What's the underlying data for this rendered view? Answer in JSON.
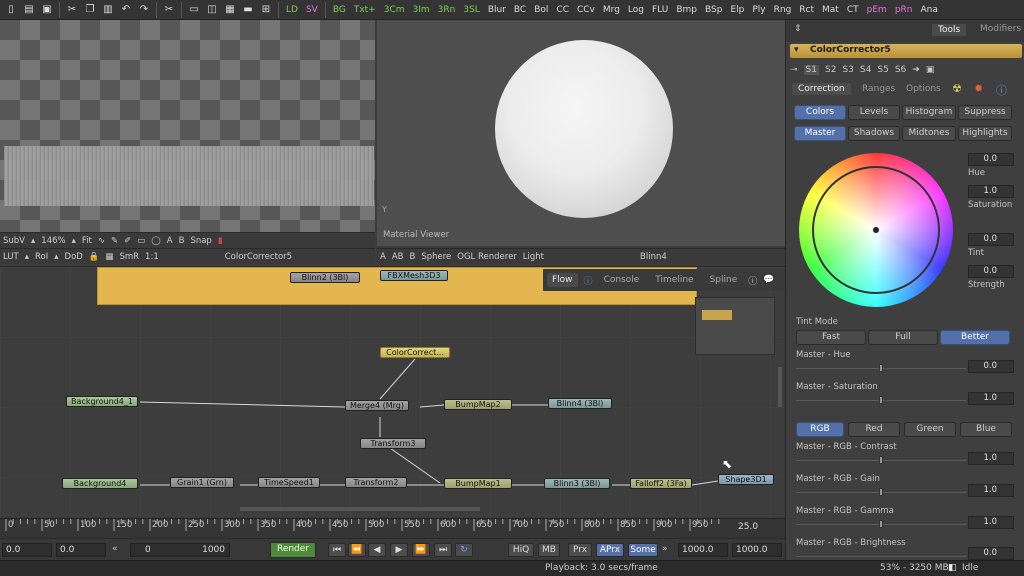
{
  "toolbar": {
    "buttons": [
      "LD",
      "SV",
      "BG",
      "Txt+",
      "3Cm",
      "3Im",
      "3Rn",
      "3SL",
      "Blur",
      "BC",
      "Bol",
      "CC",
      "CCv",
      "Mrg",
      "Log",
      "FLU",
      "Bmp",
      "BSp",
      "Elp",
      "Ply",
      "Rng",
      "Rct",
      "Mat",
      "CT",
      "pEm",
      "pRn",
      "Ana"
    ]
  },
  "viewer_left": {
    "toolbar1": {
      "subv": "SubV",
      "zoom": "146%",
      "fit": "Fit",
      "smr": "SmR",
      "snap": "Snap"
    },
    "toolbar2": {
      "lut": "LUT",
      "roi": "RoI",
      "dod": "DoD",
      "smr": "SmR",
      "ratio": "1:1",
      "node": "ColorCorrector5"
    }
  },
  "viewer_right": {
    "label": "Material Viewer",
    "toolbar": {
      "shape": "Sphere",
      "renderer": "OGL Renderer",
      "light": "Light",
      "node": "Blinn4"
    }
  },
  "flow": {
    "tabs": [
      "Flow",
      "Console",
      "Timeline",
      "Spline"
    ],
    "nodes": {
      "blinn2": "Blinn2 (3Bl)",
      "fbxmesh": "FBXMesh3D3",
      "colorcorrect": "ColorCorrect...",
      "background4_1": "Background4_1",
      "merge4": "Merge4 (Mrg)",
      "bumpmap2": "BumpMap2",
      "blinn4": "Blinn4 (3Bl)",
      "transform3": "Transform3",
      "background4": "Background4",
      "grain1": "Grain1 (Grn)",
      "timespeed1": "TimeSpeed1",
      "transform2": "Transform2",
      "bumpmap1": "BumpMap1",
      "blinn3": "Blinn3 (3Bl)",
      "falloff2": "Falloff2 (3Fa)",
      "shape3d1": "Shape3D1"
    }
  },
  "timeline": {
    "ticks": [
      "0",
      "50",
      "100",
      "150",
      "200",
      "250",
      "300",
      "350",
      "400",
      "450",
      "500",
      "550",
      "600",
      "650",
      "700",
      "750",
      "800",
      "850",
      "900",
      "950"
    ],
    "current_frame": "25.0"
  },
  "transport": {
    "start": "0.0",
    "global_start": "0.0",
    "range_start": "0",
    "range_end": "1000",
    "render": "Render",
    "hiq": "HiQ",
    "mb": "MB",
    "prx": "Prx",
    "aprx": "APrx",
    "some": "Some",
    "end": "1000.0",
    "global_end": "1000.0"
  },
  "status": {
    "playback": "Playback: 3.0 secs/frame",
    "memory": "53% - 3250 MB",
    "state": "Idle"
  },
  "rightpanel": {
    "tabs": [
      "Tools",
      "Modifiers"
    ],
    "tool_name": "ColorCorrector5",
    "slots": [
      "S1",
      "S2",
      "S3",
      "S4",
      "S5",
      "S6"
    ],
    "subtabs": [
      "Correction",
      "Ranges",
      "Options"
    ],
    "mode_buttons": [
      "Colors",
      "Levels",
      "Histogram",
      "Suppress"
    ],
    "range_buttons": [
      "Master",
      "Shadows",
      "Midtones",
      "Highlights"
    ],
    "wheel_values": [
      {
        "value": "0.0",
        "label": "Hue"
      },
      {
        "value": "1.0",
        "label": "Saturation"
      },
      {
        "value": "0.0",
        "label": "Tint"
      },
      {
        "value": "0.0",
        "label": "Strength"
      }
    ],
    "tint_mode_label": "Tint Mode",
    "tint_modes": [
      "Fast",
      "Full",
      "Better"
    ],
    "master_hue": {
      "label": "Master - Hue",
      "value": "0.0"
    },
    "master_saturation": {
      "label": "Master - Saturation",
      "value": "1.0"
    },
    "channels": [
      "RGB",
      "Red",
      "Green",
      "Blue"
    ],
    "sliders": [
      {
        "label": "Master - RGB - Contrast",
        "value": "1.0"
      },
      {
        "label": "Master - RGB - Gain",
        "value": "1.0"
      },
      {
        "label": "Master - RGB - Gamma",
        "value": "1.0"
      },
      {
        "label": "Master - RGB - Brightness",
        "value": "0.0"
      }
    ]
  },
  "colors": {
    "accent": "#5470a8",
    "underlay": "#e3b64f"
  }
}
